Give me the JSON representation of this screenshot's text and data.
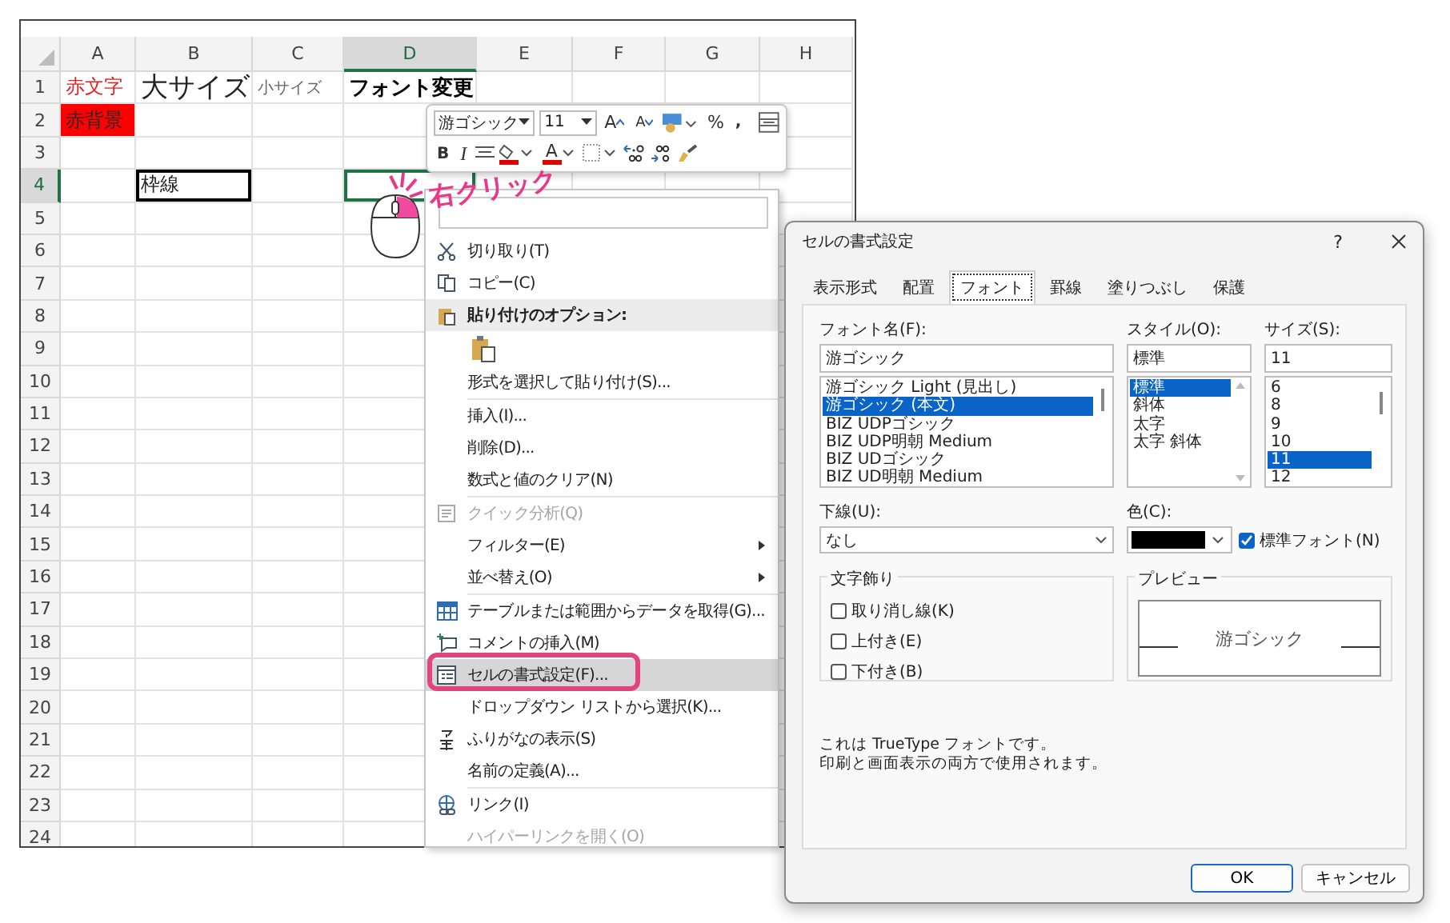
{
  "spreadsheet": {
    "columns": [
      {
        "label": "A",
        "selected": false
      },
      {
        "label": "B",
        "selected": false
      },
      {
        "label": "C",
        "selected": false
      },
      {
        "label": "D",
        "selected": true
      },
      {
        "label": "E",
        "selected": false
      },
      {
        "label": "F",
        "selected": false
      },
      {
        "label": "G",
        "selected": false
      },
      {
        "label": "H",
        "selected": false
      }
    ],
    "rows": [
      {
        "label": "1",
        "selected": false,
        "cells": [
          {
            "kind": "red-text",
            "text": "赤文字"
          },
          {
            "kind": "large",
            "text": "大サイズ"
          },
          {
            "kind": "small",
            "text": "小サイズ"
          },
          {
            "kind": "bold-font",
            "text": "フォント変更"
          }
        ]
      },
      {
        "label": "2",
        "selected": false,
        "cells": [
          {
            "kind": "red-fill",
            "text": "赤背景"
          }
        ]
      },
      {
        "label": "3",
        "selected": false
      },
      {
        "label": "4",
        "selected": true,
        "cells": [
          {
            "kind": "empty"
          },
          {
            "kind": "bordered",
            "text": "枠線"
          },
          {
            "kind": "empty"
          },
          {
            "kind": "active"
          }
        ]
      },
      {
        "label": "5",
        "selected": false
      },
      {
        "label": "6",
        "selected": false
      },
      {
        "label": "7",
        "selected": false
      },
      {
        "label": "8",
        "selected": false
      },
      {
        "label": "9",
        "selected": false
      },
      {
        "label": "10",
        "selected": false
      },
      {
        "label": "11",
        "selected": false
      },
      {
        "label": "12",
        "selected": false
      },
      {
        "label": "13",
        "selected": false
      },
      {
        "label": "14",
        "selected": false
      },
      {
        "label": "15",
        "selected": false
      },
      {
        "label": "16",
        "selected": false
      },
      {
        "label": "17",
        "selected": false
      },
      {
        "label": "18",
        "selected": false
      },
      {
        "label": "19",
        "selected": false
      },
      {
        "label": "20",
        "selected": false
      },
      {
        "label": "21",
        "selected": false
      },
      {
        "label": "22",
        "selected": false
      },
      {
        "label": "23",
        "selected": false
      },
      {
        "label": "24",
        "selected": false
      }
    ]
  },
  "callout": {
    "text": "右クリック"
  },
  "mini_toolbar": {
    "top_row": [
      {
        "kind": "font-select",
        "value": "游ゴシック"
      },
      {
        "kind": "size-select",
        "value": "11"
      },
      {
        "kind": "grow-font",
        "text": "A"
      },
      {
        "kind": "shrink-font",
        "text": "A"
      },
      {
        "kind": "number-format"
      },
      {
        "kind": "percent",
        "text": "%"
      },
      {
        "kind": "comma",
        "text": ","
      },
      {
        "kind": "cell-style"
      }
    ],
    "bottom_row": [
      {
        "kind": "bold",
        "text": "B"
      },
      {
        "kind": "italic",
        "text": "I"
      },
      {
        "kind": "align"
      },
      {
        "kind": "fill-color"
      },
      {
        "kind": "font-color",
        "text": "A"
      },
      {
        "kind": "borders"
      },
      {
        "kind": "increase-decimal"
      },
      {
        "kind": "decrease-decimal"
      },
      {
        "kind": "format-painter"
      }
    ]
  },
  "context_menu": {
    "items": [
      {
        "kind": "search"
      },
      {
        "kind": "item",
        "label": "切り取り(T)",
        "disabled": false,
        "submenu": false,
        "selected": false
      },
      {
        "kind": "item",
        "label": "コピー(C)",
        "disabled": false,
        "submenu": false,
        "selected": false
      },
      {
        "kind": "header",
        "label": "貼り付けのオプション:"
      },
      {
        "kind": "paste-options"
      },
      {
        "kind": "item",
        "label": "形式を選択して貼り付け(S)...",
        "disabled": false,
        "submenu": false,
        "selected": false
      },
      {
        "kind": "separator"
      },
      {
        "kind": "item",
        "label": "挿入(I)...",
        "disabled": false,
        "submenu": false,
        "selected": false
      },
      {
        "kind": "item",
        "label": "削除(D)...",
        "disabled": false,
        "submenu": false,
        "selected": false
      },
      {
        "kind": "item",
        "label": "数式と値のクリア(N)",
        "disabled": false,
        "submenu": false,
        "selected": false
      },
      {
        "kind": "separator"
      },
      {
        "kind": "item",
        "label": "クイック分析(Q)",
        "disabled": true,
        "submenu": false,
        "selected": false
      },
      {
        "kind": "item",
        "label": "フィルター(E)",
        "disabled": false,
        "submenu": true,
        "selected": false
      },
      {
        "kind": "item",
        "label": "並べ替え(O)",
        "disabled": false,
        "submenu": true,
        "selected": false
      },
      {
        "kind": "separator"
      },
      {
        "kind": "item",
        "label": "テーブルまたは範囲からデータを取得(G)...",
        "disabled": false,
        "submenu": false,
        "selected": false
      },
      {
        "kind": "item",
        "label": "コメントの挿入(M)",
        "disabled": false,
        "submenu": false,
        "selected": false
      },
      {
        "kind": "item",
        "label": "セルの書式設定(F)...",
        "disabled": false,
        "submenu": false,
        "selected": true
      },
      {
        "kind": "item",
        "label": "ドロップダウン リストから選択(K)...",
        "disabled": false,
        "submenu": false,
        "selected": false
      },
      {
        "kind": "item",
        "label": "ふりがなの表示(S)",
        "disabled": false,
        "submenu": false,
        "selected": false
      },
      {
        "kind": "item",
        "label": "名前の定義(A)...",
        "disabled": false,
        "submenu": false,
        "selected": false
      },
      {
        "kind": "separator"
      },
      {
        "kind": "item",
        "label": "リンク(I)",
        "disabled": false,
        "submenu": false,
        "selected": false
      },
      {
        "kind": "item",
        "label": "ハイパーリンクを開く(O)",
        "disabled": true,
        "submenu": false,
        "selected": false
      }
    ]
  },
  "dialog": {
    "title": "セルの書式設定",
    "help": "?",
    "tabs": [
      {
        "label": "表示形式",
        "selected": false
      },
      {
        "label": "配置",
        "selected": false
      },
      {
        "label": "フォント",
        "selected": true
      },
      {
        "label": "罫線",
        "selected": false
      },
      {
        "label": "塗りつぶし",
        "selected": false
      },
      {
        "label": "保護",
        "selected": false
      }
    ],
    "font_name": {
      "label": "フォント名(F):",
      "value": "游ゴシック",
      "options": [
        {
          "text": "游ゴシック Light (見出し)",
          "selected": false
        },
        {
          "text": "游ゴシック (本文)",
          "selected": true
        },
        {
          "text": "BIZ UDPゴシック",
          "selected": false
        },
        {
          "text": "BIZ UDP明朝 Medium",
          "selected": false
        },
        {
          "text": "BIZ UDゴシック",
          "selected": false
        },
        {
          "text": "BIZ UD明朝 Medium",
          "selected": false
        }
      ]
    },
    "style": {
      "label": "スタイル(O):",
      "value": "標準",
      "options": [
        {
          "text": "標準",
          "selected": true
        },
        {
          "text": "斜体",
          "selected": false
        },
        {
          "text": "太字",
          "selected": false
        },
        {
          "text": "太字 斜体",
          "selected": false
        }
      ]
    },
    "size": {
      "label": "サイズ(S):",
      "value": "11",
      "options": [
        {
          "text": "6",
          "selected": false
        },
        {
          "text": "8",
          "selected": false
        },
        {
          "text": "9",
          "selected": false
        },
        {
          "text": "10",
          "selected": false
        },
        {
          "text": "11",
          "selected": true
        },
        {
          "text": "12",
          "selected": false
        }
      ]
    },
    "underline": {
      "label": "下線(U):",
      "value": "なし"
    },
    "color": {
      "label": "色(C):",
      "color": "#000000"
    },
    "normal_font": {
      "label": "標準フォント(N)",
      "checked": true
    },
    "effects": {
      "title": "文字飾り",
      "options": [
        {
          "label": "取り消し線(K)",
          "checked": false
        },
        {
          "label": "上付き(E)",
          "checked": false
        },
        {
          "label": "下付き(B)",
          "checked": false
        }
      ]
    },
    "preview": {
      "title": "プレビュー",
      "text": "游ゴシック"
    },
    "description": [
      "これは TrueType フォントです。",
      "印刷と画面表示の両方で使用されます。"
    ],
    "buttons": [
      {
        "label": "OK",
        "default": true
      },
      {
        "label": "キャンセル",
        "default": false
      }
    ]
  }
}
